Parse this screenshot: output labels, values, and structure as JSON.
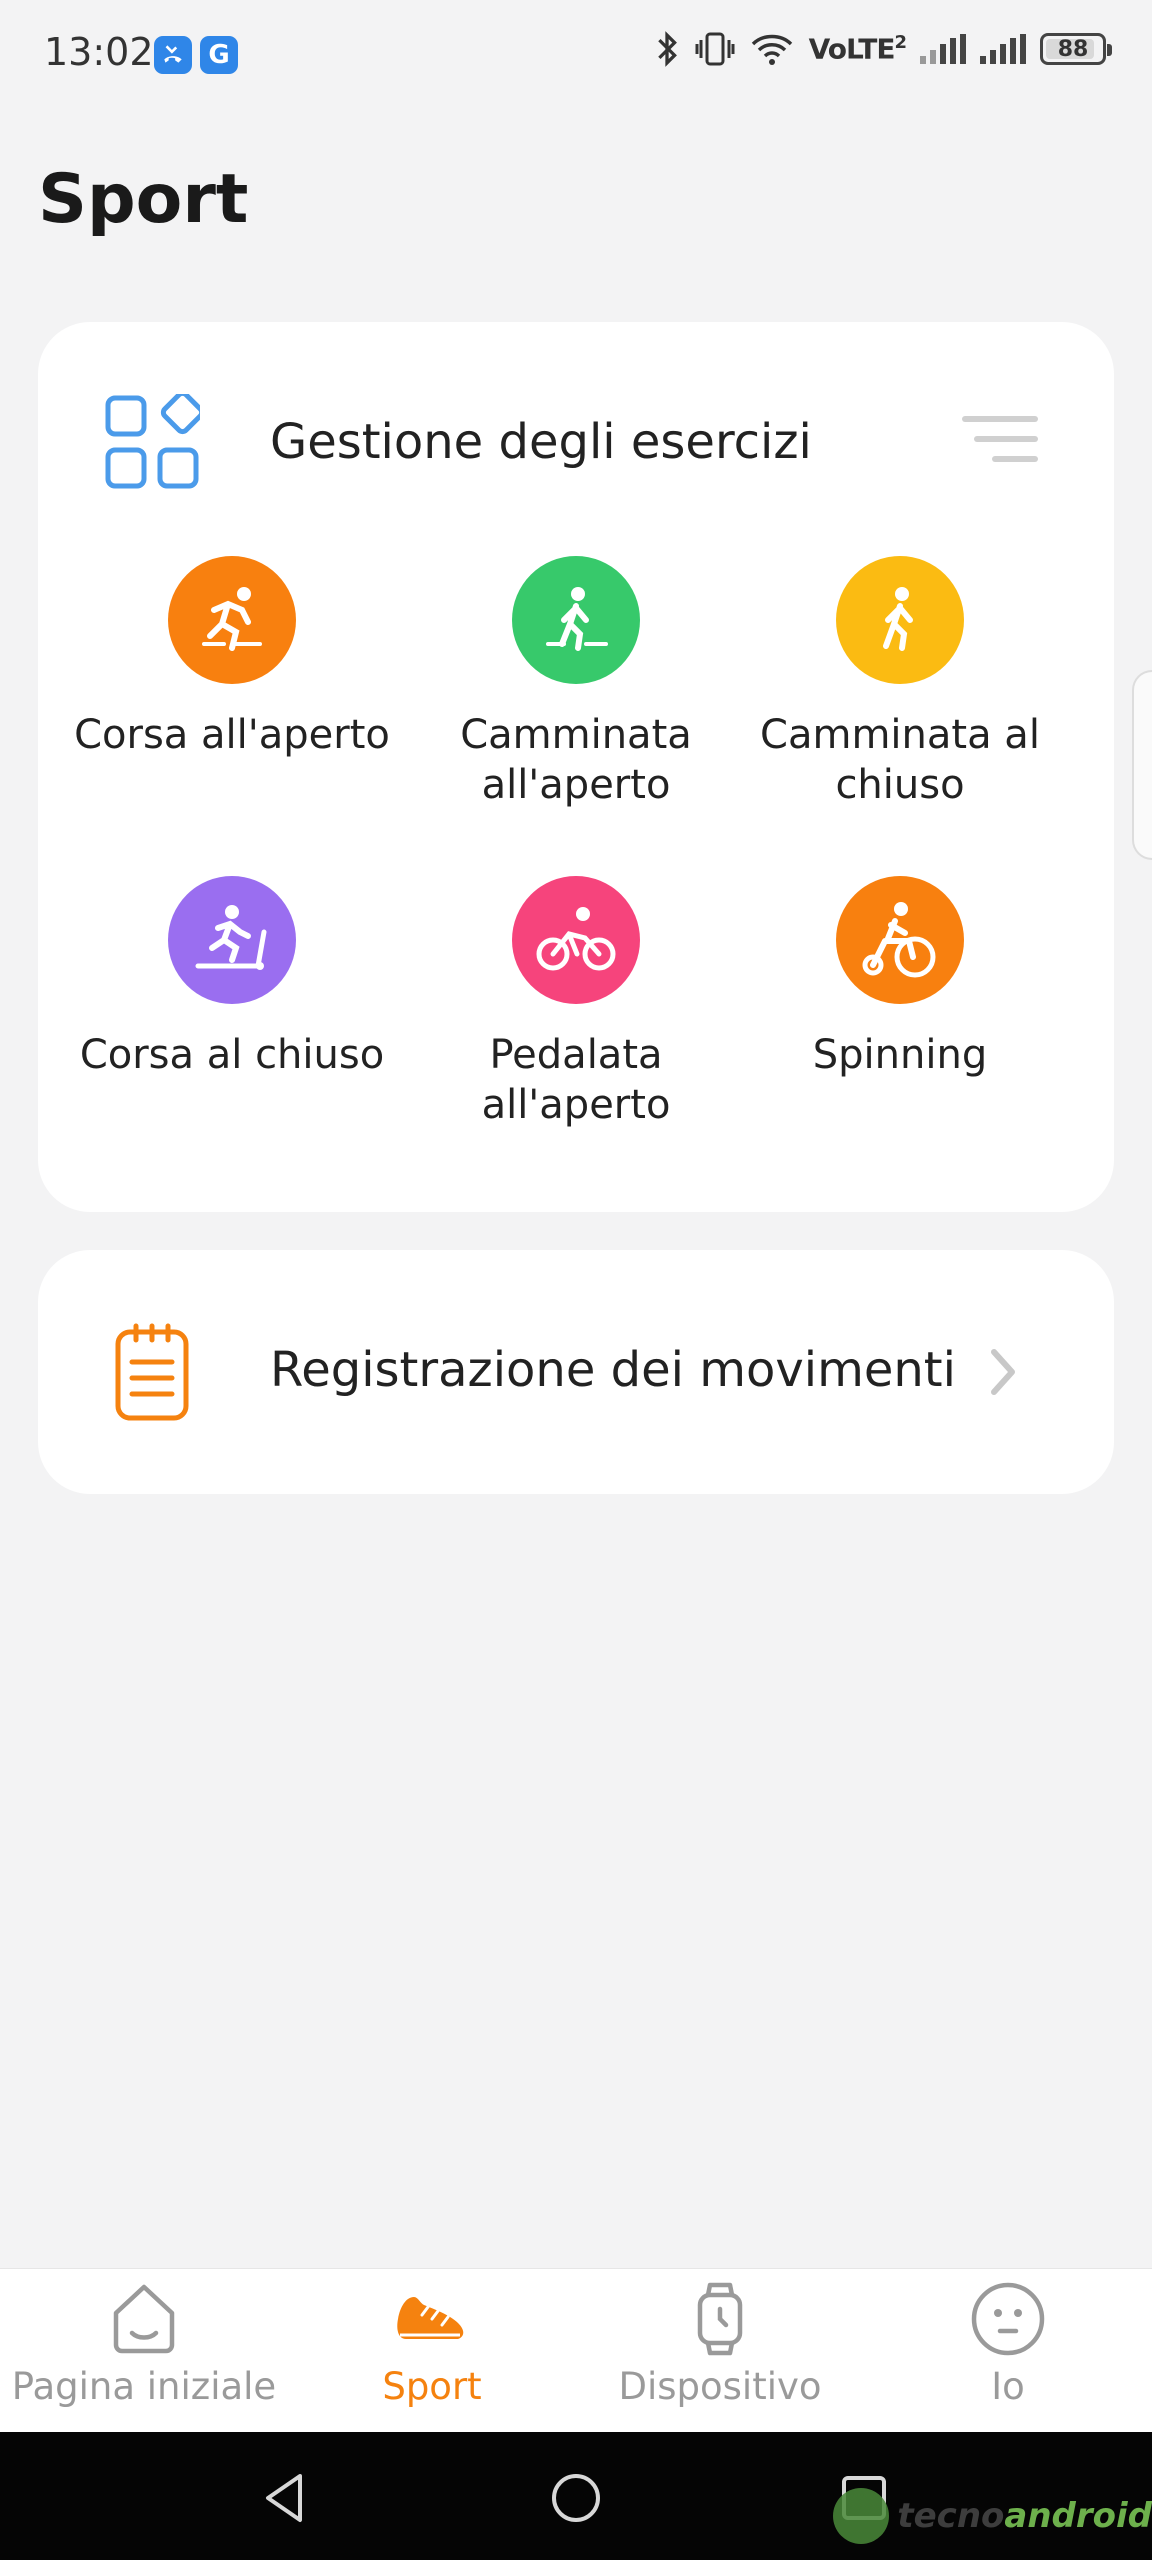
{
  "status_bar": {
    "time": "13:02",
    "volte_label": "VoLTE",
    "volte_sup": "2",
    "battery": "88",
    "app_icon_g": "G"
  },
  "page": {
    "title": "Sport"
  },
  "exercises_card": {
    "title": "Gestione degli esercizi",
    "items": [
      {
        "label": "Corsa all'aperto",
        "color": "#f8800f",
        "icon": "outdoor-run-icon"
      },
      {
        "label": "Camminata all'aperto",
        "color": "#37c96b",
        "icon": "outdoor-walk-icon"
      },
      {
        "label": "Camminata al chiuso",
        "color": "#fbbb12",
        "icon": "indoor-walk-icon"
      },
      {
        "label": "Corsa al chiuso",
        "color": "#9a6ef0",
        "icon": "treadmill-icon"
      },
      {
        "label": "Pedalata all'aperto",
        "color": "#f6447c",
        "icon": "outdoor-cycling-icon"
      },
      {
        "label": "Spinning",
        "color": "#f8800f",
        "icon": "spinning-icon"
      }
    ]
  },
  "records_card": {
    "label": "Registrazione dei movimenti"
  },
  "bottom_nav": {
    "items": [
      {
        "label": "Pagina iniziale"
      },
      {
        "label": "Sport"
      },
      {
        "label": "Dispositivo"
      },
      {
        "label": "Io"
      }
    ],
    "active_index": 1,
    "active_color": "#f5820f"
  },
  "watermark": {
    "part1": "tecno",
    "part2": "android"
  }
}
